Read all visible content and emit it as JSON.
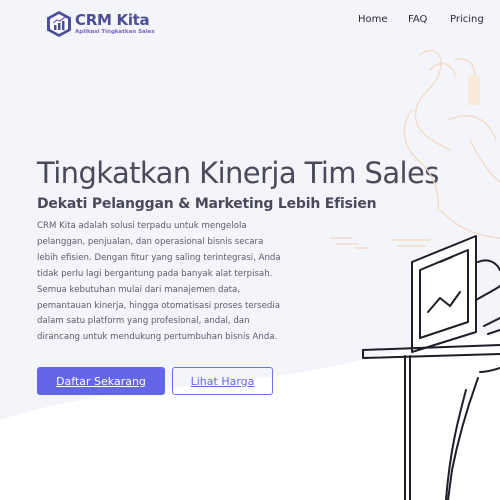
{
  "brand": {
    "name": "CRM Kita",
    "tagline": "Aplikasi Tingkatkan Sales",
    "colors": {
      "primary": "#6366e8",
      "logo": "#4b4f9a",
      "accent": "#7b63c9"
    }
  },
  "nav": {
    "items": [
      {
        "label": "Home"
      },
      {
        "label": "FAQ"
      },
      {
        "label": "Pricing"
      }
    ]
  },
  "hero": {
    "title": "Tingkatkan Kinerja Tim Sales",
    "subtitle": "Dekati Pelanggan & Marketing Lebih Efisien",
    "description": "CRM Kita adalah solusi terpadu untuk mengelola pelanggan, penjualan, dan operasional bisnis secara lebih efisien. Dengan fitur yang saling terintegrasi, Anda tidak perlu lagi bergantung pada banyak alat terpisah. Semua kebutuhan mulai dari manajemen data, pemantauan kinerja, hingga otomatisasi proses tersedia dalam satu platform yang profesional, andal, dan dirancang untuk mendukung pertumbuhan bisnis Anda.",
    "primary_button": "Daftar Sekarang",
    "secondary_button": "Lihat Harga"
  },
  "icons": {
    "logo": "growth-chart-hexagon-icon"
  }
}
